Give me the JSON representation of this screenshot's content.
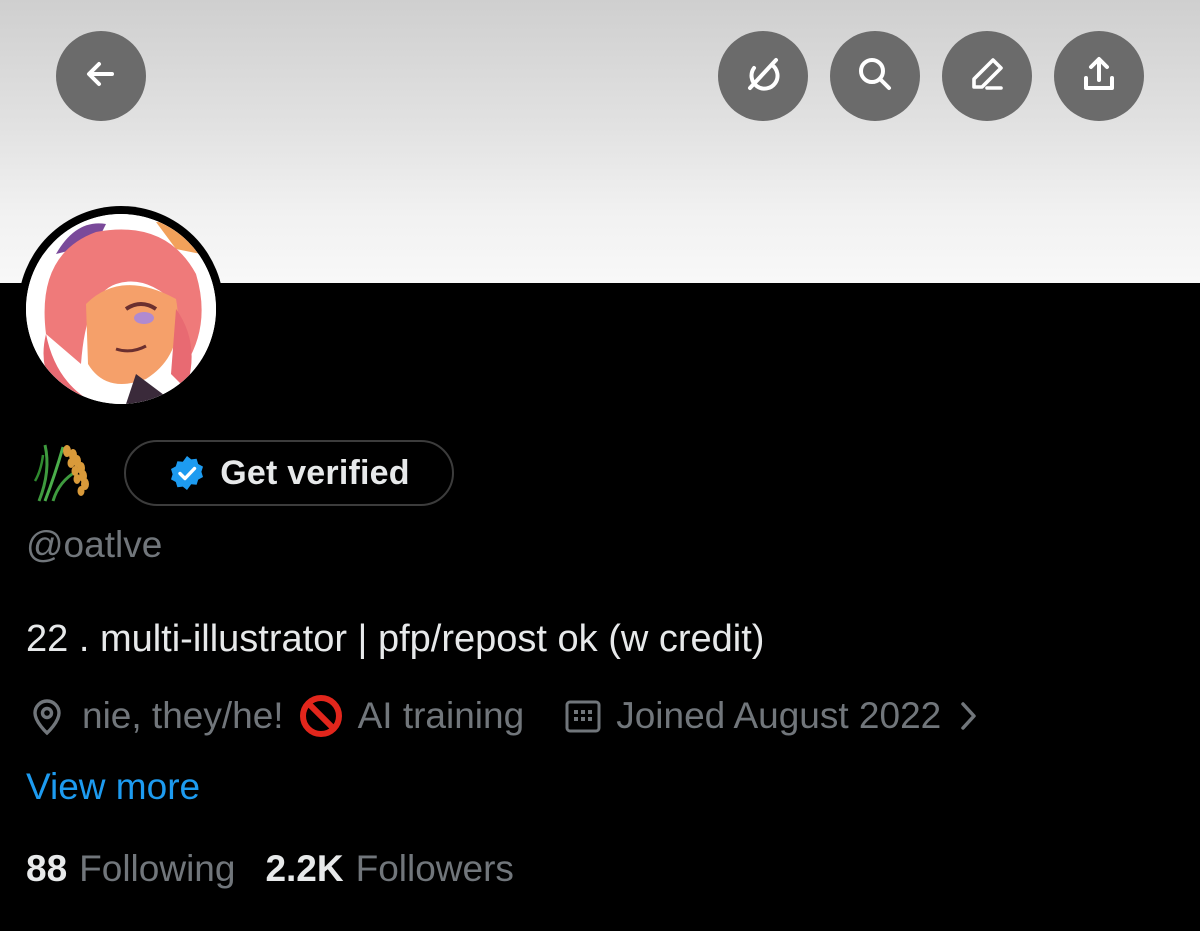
{
  "header": {
    "back_icon": "arrow-left-icon",
    "actions": [
      {
        "name": "grok-icon"
      },
      {
        "name": "search-icon"
      },
      {
        "name": "edit-icon"
      },
      {
        "name": "share-icon"
      }
    ],
    "button_color": "#6b6b6b"
  },
  "profile": {
    "name_emoji": "🌾",
    "verify_label": "Get verified",
    "handle": "@oatlve",
    "bio": "22 . multi-illustrator | pfp/repost ok (w credit)",
    "location": "nie, they/he!",
    "location_suffix_emoji": "🚫",
    "location_suffix_text": "AI training",
    "joined": "Joined August 2022",
    "view_more": "View more",
    "following_count": "88",
    "following_label": "Following",
    "followers_count": "2.2K",
    "followers_label": "Followers"
  },
  "colors": {
    "accent": "#1d9bf0",
    "text_primary": "#e7e9ea",
    "text_secondary": "#71767b",
    "background": "#000000"
  }
}
